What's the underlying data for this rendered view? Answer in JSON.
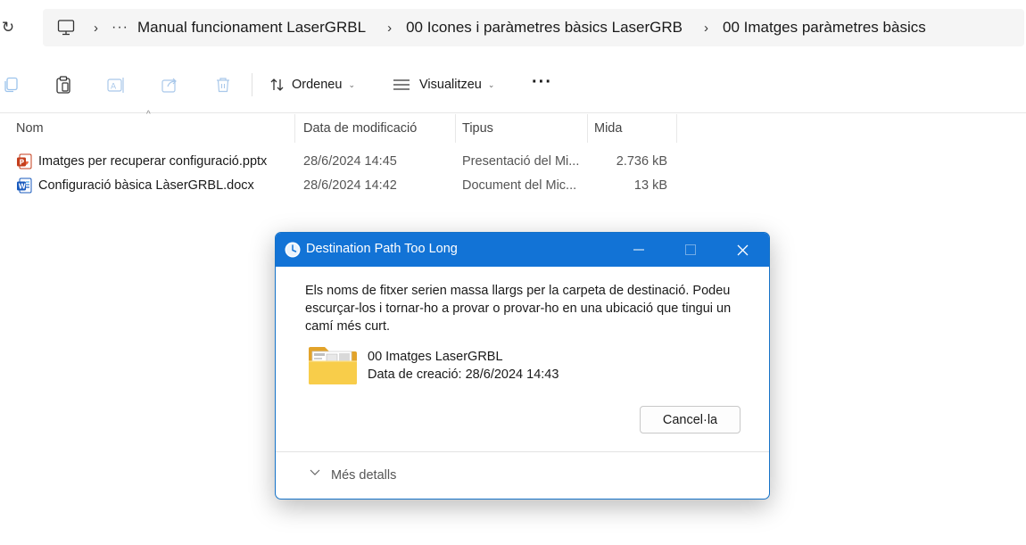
{
  "address": {
    "ellipsis": "···",
    "breadcrumbs": [
      "Manual funcionament LaserGRBL",
      "00 Icones i paràmetres bàsics LaserGRB",
      "00 Imatges paràmetres bàsics"
    ],
    "separator": "›",
    "refresh_glyph": "↻"
  },
  "commandbar": {
    "sort_label": "Ordeneu",
    "view_label": "Visualitzeu",
    "more_label": "···",
    "icons": [
      "copy-icon",
      "paste-icon",
      "rename-icon",
      "share-icon",
      "delete-icon"
    ]
  },
  "list": {
    "columns": [
      "Nom",
      "Data de modificació",
      "Tipus",
      "Mida"
    ],
    "rows": [
      {
        "name": "Imatges per recuperar configuració.pptx",
        "date": "28/6/2024 14:45",
        "type": "Presentació del Mi...",
        "size": "2.736 kB",
        "icon": "powerpoint-file-icon"
      },
      {
        "name": "Configuració bàsica LàserGRBL.docx",
        "date": "28/6/2024 14:42",
        "type": "Document del Mic...",
        "size": "13 kB",
        "icon": "word-file-icon"
      }
    ]
  },
  "dialog": {
    "title": "Destination Path Too Long",
    "message": "Els noms de fitxer serien massa llargs per la carpeta de destinació. Podeu escurçar-los i tornar-ho a provar o provar-ho en una ubicació que tingui un camí més curt.",
    "item_name": "00 Imatges LaserGRBL",
    "item_date": "Data de creació: 28/6/2024 14:43",
    "cancel_label": "Cancel·la",
    "details_label": "Més detalls"
  },
  "colors": {
    "accent": "#1273d6",
    "ppt": "#c43e1c",
    "word": "#185abd",
    "folder": "#f4c430"
  }
}
